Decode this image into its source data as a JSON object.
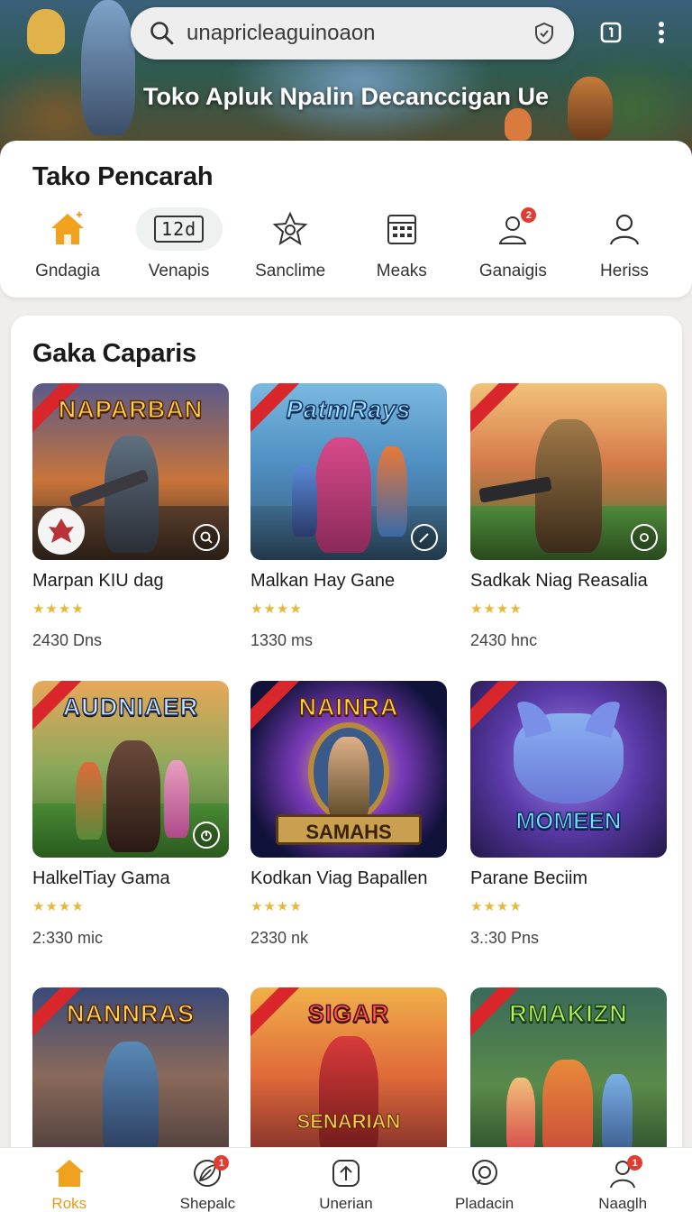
{
  "header": {
    "search_query": "unapricleaguinoaon",
    "banner_title": "Toko Apluk Npalin Decanccigan Ue"
  },
  "categories": {
    "title": "Tako Pencarah",
    "items": [
      {
        "label": "Gndagia",
        "icon": "home-icon"
      },
      {
        "label": "Venapis",
        "icon": "date-icon",
        "value": "12d"
      },
      {
        "label": "Sanclime",
        "icon": "star-badge-icon"
      },
      {
        "label": "Meaks",
        "icon": "calendar-grid-icon"
      },
      {
        "label": "Ganaigis",
        "icon": "user-group-icon",
        "badge": "2"
      },
      {
        "label": "Heriss",
        "icon": "user-icon"
      }
    ]
  },
  "games": {
    "title": "Gaka Caparis",
    "items": [
      {
        "name": "Marpan KIU dag",
        "logo": "NAPARBAN",
        "rating": 4,
        "meta": "2430 Dns"
      },
      {
        "name": "Malkan Hay Gane",
        "logo": "PatmRays",
        "rating": 4,
        "meta": "1330 ms"
      },
      {
        "name": "Sadkak Niag Reasalia",
        "logo": "",
        "rating": 4,
        "meta": "2430 hnc"
      },
      {
        "name": "HalkelTiay Gama",
        "logo": "AUDNIAER",
        "rating": 4,
        "meta": "2:330 mic"
      },
      {
        "name": "Kodkan Viag Bapallen",
        "logo": "NAINRA",
        "logo2": "SAMAHS",
        "rating": 4,
        "meta": "2330 nk"
      },
      {
        "name": "Parane Beciim",
        "logo": "MOMEEN",
        "rating": 4,
        "meta": "3.:30 Pns"
      },
      {
        "name": "",
        "logo": "NANNRAS",
        "rating": 0,
        "meta": ""
      },
      {
        "name": "",
        "logo": "SIGAR",
        "logo2": "SENARIAN",
        "rating": 0,
        "meta": ""
      },
      {
        "name": "",
        "logo": "RMAKIZN",
        "rating": 0,
        "meta": ""
      }
    ]
  },
  "bottom_nav": {
    "items": [
      {
        "label": "Roks",
        "icon": "home-icon",
        "active": true
      },
      {
        "label": "Shepalc",
        "icon": "leaf-icon",
        "badge": "1"
      },
      {
        "label": "Unerian",
        "icon": "upload-icon"
      },
      {
        "label": "Pladacin",
        "icon": "chat-icon"
      },
      {
        "label": "Naaglh",
        "icon": "profile-icon",
        "badge": "1"
      }
    ]
  },
  "colors": {
    "accent": "#f0a21e",
    "badge": "#e23b30",
    "star": "#e8b83a"
  }
}
